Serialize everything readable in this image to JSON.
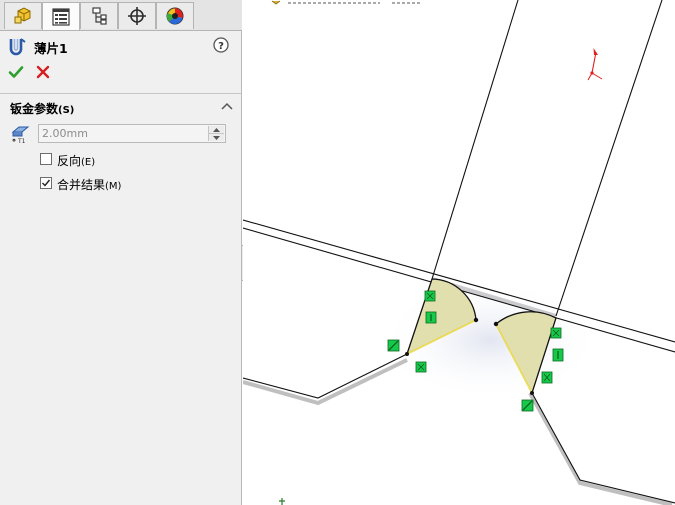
{
  "feature_title": "薄片1",
  "group": {
    "title": "钣金参数",
    "shortcut": "(S)"
  },
  "thickness": {
    "value": "2.00mm"
  },
  "checkboxes": [
    {
      "label": "反向",
      "shortcut": "(E)",
      "checked": false
    },
    {
      "label": "合并结果",
      "shortcut": "(M)",
      "checked": true
    }
  ],
  "tabs": [
    {
      "icon": "feature-manager-icon"
    },
    {
      "icon": "property-manager-icon",
      "active": true
    },
    {
      "icon": "configuration-manager-icon"
    },
    {
      "icon": "dimxpert-manager-icon"
    },
    {
      "icon": "display-manager-icon"
    }
  ],
  "colors": {
    "accept": "#2e9e2e",
    "cancel": "#d32020",
    "handle": "#17c94b",
    "flange_fill": "#e2dfae",
    "panel_bg": "#f0f0f0"
  }
}
